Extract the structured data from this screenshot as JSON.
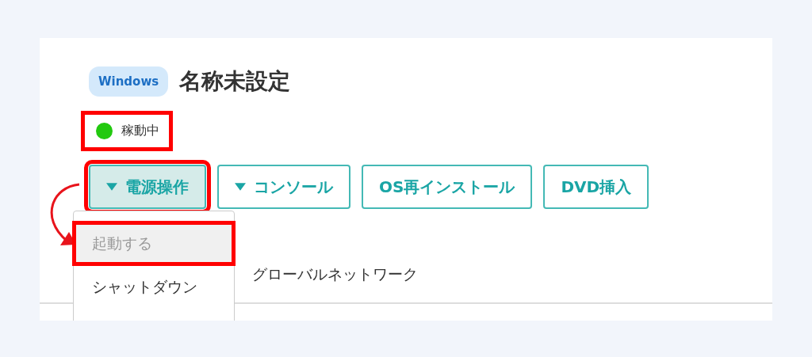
{
  "server": {
    "os_badge": "Windows",
    "name": "名称未設定"
  },
  "status": {
    "label": "稼動中",
    "color": "#22c90f",
    "highlighted": true
  },
  "buttons": [
    {
      "label": "電源操作",
      "has_caret": true,
      "expanded": true,
      "highlighted": true
    },
    {
      "label": "コンソール",
      "has_caret": true,
      "expanded": false,
      "highlighted": false
    },
    {
      "label": "OS再インストール",
      "has_caret": false,
      "expanded": false,
      "highlighted": false
    },
    {
      "label": "DVD挿入",
      "has_caret": false,
      "expanded": false,
      "highlighted": false
    }
  ],
  "power_menu": {
    "items": [
      {
        "label": "起動する",
        "disabled": true,
        "highlighted": true
      },
      {
        "label": "シャットダウン",
        "disabled": false,
        "highlighted": false
      }
    ]
  },
  "tabs": [
    {
      "label": "グローバルネットワーク"
    }
  ],
  "annotation": {
    "arrow": true
  }
}
